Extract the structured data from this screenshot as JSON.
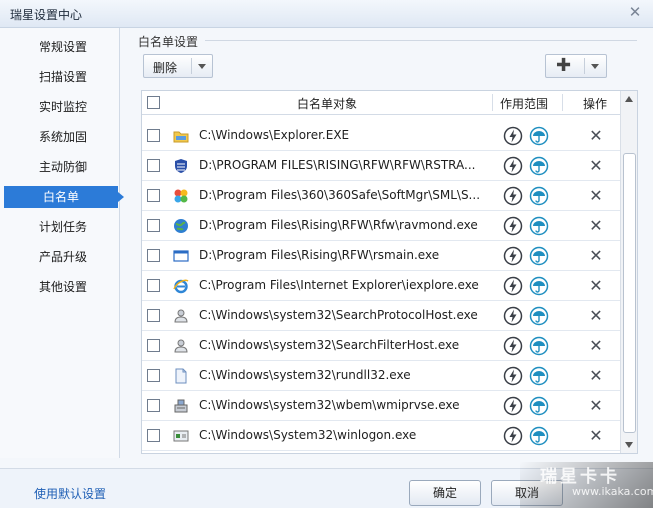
{
  "window": {
    "title": "瑞星设置中心",
    "close_icon": "close-icon"
  },
  "sidebar": {
    "items": [
      {
        "label": "常规设置",
        "active": false
      },
      {
        "label": "扫描设置",
        "active": false
      },
      {
        "label": "实时监控",
        "active": false
      },
      {
        "label": "系统加固",
        "active": false
      },
      {
        "label": "主动防御",
        "active": false
      },
      {
        "label": "白名单",
        "active": true
      },
      {
        "label": "计划任务",
        "active": false
      },
      {
        "label": "产品升级",
        "active": false
      },
      {
        "label": "其他设置",
        "active": false
      }
    ]
  },
  "main": {
    "section_title": "白名单设置",
    "toolbar": {
      "delete_label": "删除",
      "add_icon": "plus-icon"
    },
    "table": {
      "columns": {
        "object": "白名单对象",
        "scope": "作用范围",
        "action": "操作"
      },
      "rows": [
        {
          "path": "C:\\Windows\\Explorer.EXE",
          "icon": "folder-icon"
        },
        {
          "path": "D:\\PROGRAM FILES\\RISING\\RFW\\RFW\\RSTRA...",
          "icon": "shield-app-icon"
        },
        {
          "path": "D:\\Program Files\\360\\360Safe\\SoftMgr\\SML\\S...",
          "icon": "colorful-app-icon"
        },
        {
          "path": "D:\\Program Files\\Rising\\RFW\\Rfw\\ravmond.exe",
          "icon": "globe-icon"
        },
        {
          "path": "D:\\Program Files\\Rising\\RFW\\rsmain.exe",
          "icon": "window-icon"
        },
        {
          "path": "C:\\Program Files\\Internet Explorer\\iexplore.exe",
          "icon": "internet-explorer-icon"
        },
        {
          "path": "C:\\Windows\\system32\\SearchProtocolHost.exe",
          "icon": "search-service-icon"
        },
        {
          "path": "C:\\Windows\\system32\\SearchFilterHost.exe",
          "icon": "search-service-icon"
        },
        {
          "path": "C:\\Windows\\system32\\rundll32.exe",
          "icon": "document-icon"
        },
        {
          "path": "C:\\Windows\\system32\\wbem\\wmiprvse.exe",
          "icon": "wmi-icon"
        },
        {
          "path": "C:\\Windows\\System32\\winlogon.exe",
          "icon": "console-icon"
        }
      ]
    }
  },
  "footer": {
    "default_link": "使用默认设置",
    "ok_label": "确定",
    "cancel_label": "取消"
  },
  "watermark": {
    "brand": "瑞星卡卡",
    "url": "www.ikaka.com"
  },
  "colors": {
    "accent": "#2c7bd8",
    "link": "#1f5fb5",
    "umbrella": "#1f8fc0"
  }
}
